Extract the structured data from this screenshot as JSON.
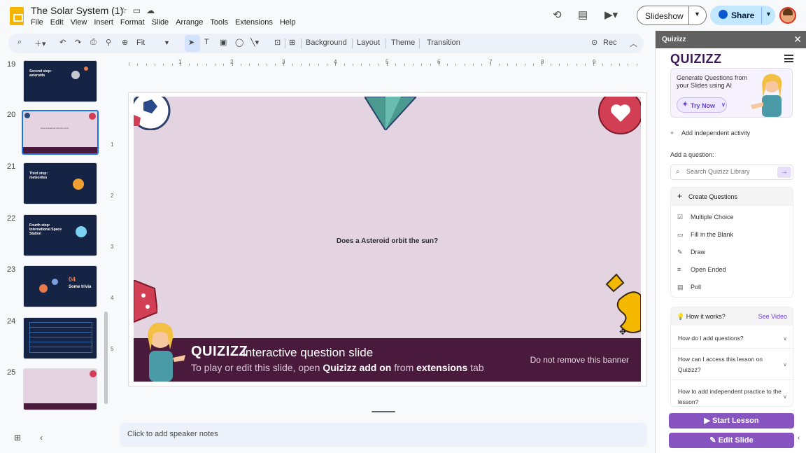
{
  "header": {
    "doc_title": "The Solar System (1)",
    "menu": [
      "File",
      "Edit",
      "View",
      "Insert",
      "Format",
      "Slide",
      "Arrange",
      "Tools",
      "Extensions",
      "Help"
    ],
    "slideshow_label": "Slideshow",
    "share_label": "Share"
  },
  "toolbar": {
    "zoom": "Fit",
    "background": "Background",
    "layout": "Layout",
    "theme": "Theme",
    "transition": "Transition",
    "rec": "Rec"
  },
  "filmstrip": {
    "slides": [
      {
        "num": "19",
        "title": "Second stop: asteroids"
      },
      {
        "num": "20",
        "title": ""
      },
      {
        "num": "21",
        "title": "Third stop: meteorites"
      },
      {
        "num": "22",
        "title": "Fourth stop: International Space Station"
      },
      {
        "num": "23",
        "title": "Some trivia",
        "number": "04"
      },
      {
        "num": "24",
        "title": ""
      },
      {
        "num": "25",
        "title": ""
      }
    ]
  },
  "ruler": {
    "h": [
      "1",
      "2",
      "3",
      "4",
      "5",
      "6",
      "7",
      "8",
      "9"
    ],
    "v": [
      "1",
      "2",
      "3",
      "4",
      "5"
    ]
  },
  "slide": {
    "question": "Does a Asteroid orbit the sun?",
    "banner_logo": "QUIZIZZ",
    "banner_title": "interactive question slide",
    "banner_sub_1": "To play or edit this slide, open ",
    "banner_sub_bold_1": "Quizizz add on",
    "banner_sub_2": " from ",
    "banner_sub_bold_2": "extensions",
    "banner_sub_3": " tab",
    "banner_warning": "Do not remove this banner"
  },
  "notes": {
    "placeholder": "Click to add speaker notes"
  },
  "panel": {
    "title": "Quizizz",
    "logo": "QUIZIZZ",
    "ai_text": "Generate Questions from your Slides using AI",
    "try_now": "Try Now",
    "add_independent": "Add independent activity",
    "add_question": "Add a question:",
    "search_placeholder": "Search Quizizz Library",
    "create_questions": "Create Questions",
    "question_types": [
      "Multiple Choice",
      "Fill in the Blank",
      "Draw",
      "Open Ended",
      "Poll"
    ],
    "how_it_works": "How it works?",
    "see_video": "See Video",
    "faqs": [
      "How do I add questions?",
      "How can I access this lesson on Quizizz?",
      "How to add independent practice to the lesson?"
    ],
    "start_lesson": "Start Lesson",
    "edit_slide": "Edit Slide"
  },
  "colors": {
    "accent_purple": "#8854c0",
    "banner": "#4a1a3d",
    "slide_bg": "#e4d3e1",
    "share_bg": "#c2e7ff"
  }
}
